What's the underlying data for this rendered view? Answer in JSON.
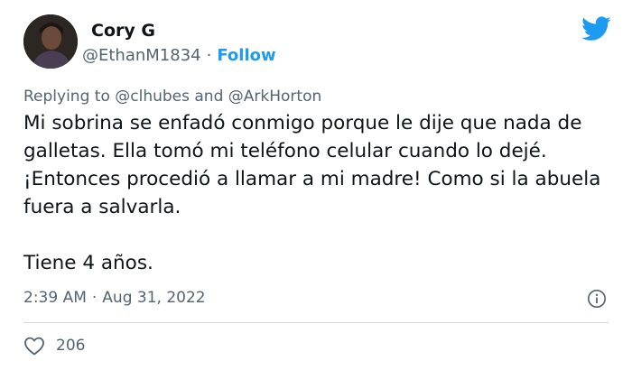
{
  "user": {
    "name": "Cory G",
    "handle": "@EthanM1834",
    "separator": "·",
    "follow_label": "Follow"
  },
  "reply": {
    "prefix": "Replying to",
    "mention1": "@clhubes",
    "conjunction": "and",
    "mention2": "@ArkHorton"
  },
  "tweet": {
    "paragraph1": "Mi sobrina se enfadó conmigo porque le dije que nada de galletas. Ella tomó mi teléfono celular cuando lo dejé. ¡Entonces procedió a llamar a mi madre! Como si la abuela fuera a salvarla.",
    "paragraph2": "Tiene 4 años."
  },
  "meta": {
    "time": "2:39 AM",
    "separator": "·",
    "date": "Aug 31, 2022"
  },
  "engagement": {
    "likes": "206"
  },
  "icons": {
    "logo": "twitter-bird-icon",
    "info": "info-icon",
    "like": "heart-icon"
  },
  "colors": {
    "accent": "#1d9bf0",
    "text": "#0f1419",
    "secondary": "#536471",
    "divider": "#cfd9de"
  }
}
